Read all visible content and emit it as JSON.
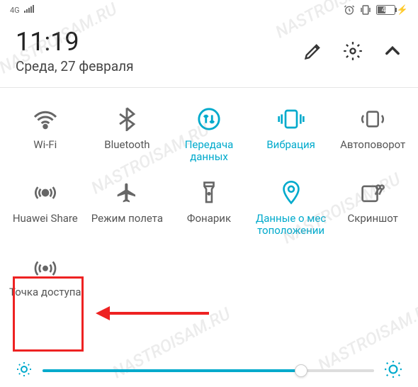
{
  "status": {
    "network": "4G",
    "battery": "46"
  },
  "header": {
    "time": "11:19",
    "date": "Среда, 27 февраля"
  },
  "tiles": [
    {
      "id": "wifi",
      "label": "Wi-Fi",
      "active": false
    },
    {
      "id": "bluetooth",
      "label": "Bluetooth",
      "active": false
    },
    {
      "id": "data",
      "label": "Передача данных",
      "active": true
    },
    {
      "id": "vibration",
      "label": "Вибрация",
      "active": true
    },
    {
      "id": "autorotate",
      "label": "Автоповорот",
      "active": false
    },
    {
      "id": "huaweishare",
      "label": "Huawei Share",
      "active": false
    },
    {
      "id": "airplane",
      "label": "Режим полета",
      "active": false
    },
    {
      "id": "flashlight",
      "label": "Фонарик",
      "active": false
    },
    {
      "id": "location",
      "label": "Данные о мес тоположении",
      "active": true
    },
    {
      "id": "screenshot",
      "label": "Скриншот",
      "active": false
    },
    {
      "id": "hotspot",
      "label": "Точка доступа",
      "active": false
    }
  ],
  "brightness": {
    "value": 78
  },
  "colors": {
    "accent": "#00aacc",
    "muted": "#666666"
  },
  "watermark": "NASTROISAM.RU"
}
